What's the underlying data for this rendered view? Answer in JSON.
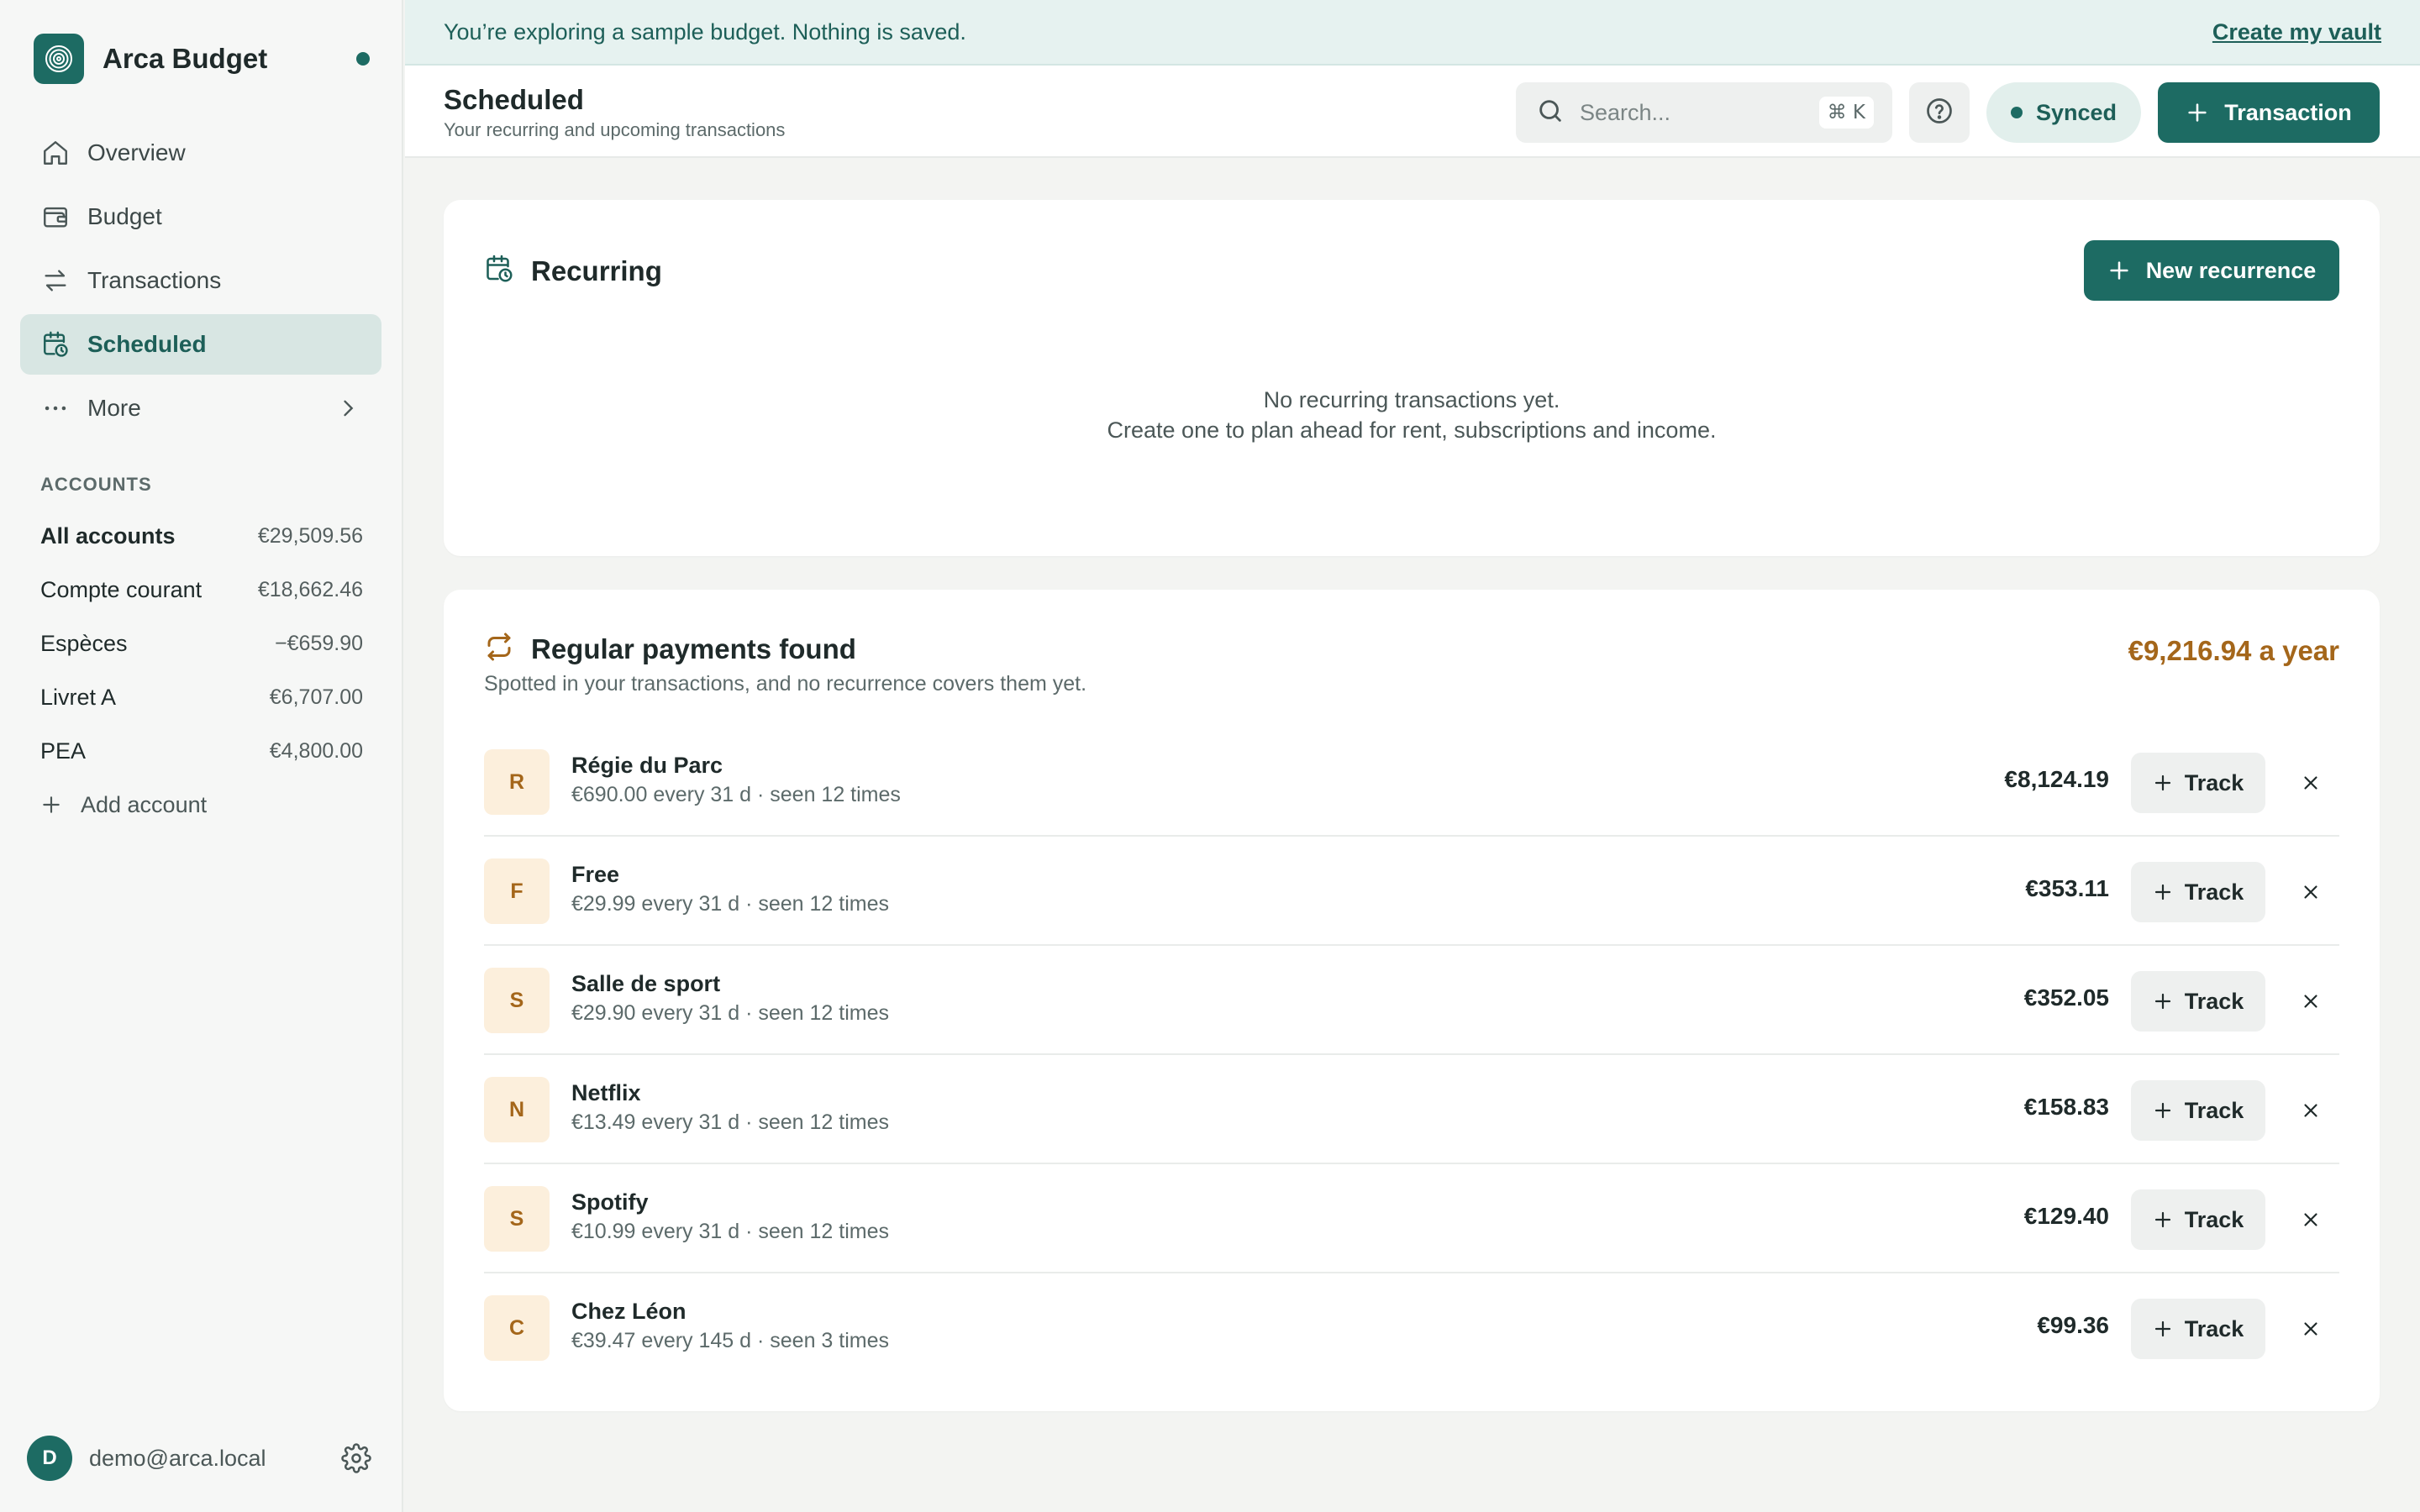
{
  "app": {
    "name": "Arca Budget"
  },
  "sidebar": {
    "nav": [
      {
        "label": "Overview",
        "icon": "home-icon"
      },
      {
        "label": "Budget",
        "icon": "wallet-icon"
      },
      {
        "label": "Transactions",
        "icon": "transfer-arrows-icon"
      },
      {
        "label": "Scheduled",
        "icon": "calendar-clock-icon",
        "active": true
      },
      {
        "label": "More",
        "icon": "dots-icon"
      }
    ],
    "accounts_title": "ACCOUNTS",
    "accounts": [
      {
        "name": "All accounts",
        "balance": "€29,509.56"
      },
      {
        "name": "Compte courant",
        "balance": "€18,662.46"
      },
      {
        "name": "Espèces",
        "balance": "−€659.90"
      },
      {
        "name": "Livret A",
        "balance": "€6,707.00"
      },
      {
        "name": "PEA",
        "balance": "€4,800.00"
      }
    ],
    "add_account": "Add account",
    "user": {
      "initial": "D",
      "email": "demo@arca.local"
    }
  },
  "banner": {
    "text": "You’re exploring a sample budget. Nothing is saved.",
    "link": "Create my vault"
  },
  "header": {
    "title": "Scheduled",
    "subtitle": "Your recurring and upcoming transactions",
    "search_placeholder": "Search...",
    "search_shortcut": "⌘ K",
    "sync_status": "Synced",
    "new_transaction": "Transaction"
  },
  "recurring": {
    "title": "Recurring",
    "new_button": "New recurrence",
    "empty_line1": "No recurring transactions yet.",
    "empty_line2": "Create one to plan ahead for rent, subscriptions and income."
  },
  "regular": {
    "title": "Regular payments found",
    "subtitle": "Spotted in your transactions, and no recurrence covers them yet.",
    "total": "€9,216.94 a year",
    "track_label": "Track",
    "items": [
      {
        "initial": "R",
        "name": "Régie du Parc",
        "meta": "€690.00 every 31 d · seen 12 times",
        "amount": "€8,124.19"
      },
      {
        "initial": "F",
        "name": "Free",
        "meta": "€29.99 every 31 d · seen 12 times",
        "amount": "€353.11"
      },
      {
        "initial": "S",
        "name": "Salle de sport",
        "meta": "€29.90 every 31 d · seen 12 times",
        "amount": "€352.05"
      },
      {
        "initial": "N",
        "name": "Netflix",
        "meta": "€13.49 every 31 d · seen 12 times",
        "amount": "€158.83"
      },
      {
        "initial": "S",
        "name": "Spotify",
        "meta": "€10.99 every 31 d · seen 12 times",
        "amount": "€129.40"
      },
      {
        "initial": "C",
        "name": "Chez Léon",
        "meta": "€39.47 every 145 d · seen 3 times",
        "amount": "€99.36"
      }
    ]
  },
  "colors": {
    "brand": "#1d6b63",
    "active_nav_bg": "#d8e6e3",
    "banner_bg": "#e6f2f0",
    "accent_amber": "#a4661a",
    "avatar_bg": "#fcefdc"
  }
}
